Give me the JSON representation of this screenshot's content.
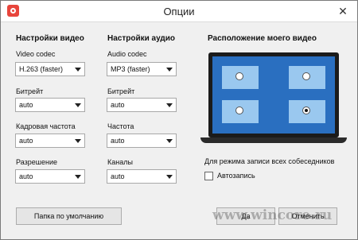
{
  "window": {
    "title": "Опции",
    "close_glyph": "✕",
    "accent": "#e8453c"
  },
  "video": {
    "heading": "Настройки видео",
    "codec_label": "Video codec",
    "codec_value": "H.263 (faster)",
    "bitrate_label": "Битрейт",
    "bitrate_value": "auto",
    "framerate_label": "Кадровая частота",
    "framerate_value": "auto",
    "resolution_label": "Разрешение",
    "resolution_value": "auto"
  },
  "audio": {
    "heading": "Настройки аудио",
    "codec_label": "Audio codec",
    "codec_value": "MP3 (faster)",
    "bitrate_label": "Битрейт",
    "bitrate_value": "auto",
    "frequency_label": "Частота",
    "frequency_value": "auto",
    "channels_label": "Каналы",
    "channels_value": "auto"
  },
  "placement": {
    "heading": "Расположение моего видео",
    "selected": "bottom-right",
    "screen_color": "#2a6fc0",
    "tile_color": "#9ac8ef"
  },
  "record": {
    "caption": "Для режима записи всех собеседников",
    "auto_label": "Автозапись",
    "auto_checked": false
  },
  "buttons": {
    "default_folder": "Папка по умолчанию",
    "ok": "Да",
    "cancel": "Отменить"
  },
  "watermark": "www.wincore.ru"
}
